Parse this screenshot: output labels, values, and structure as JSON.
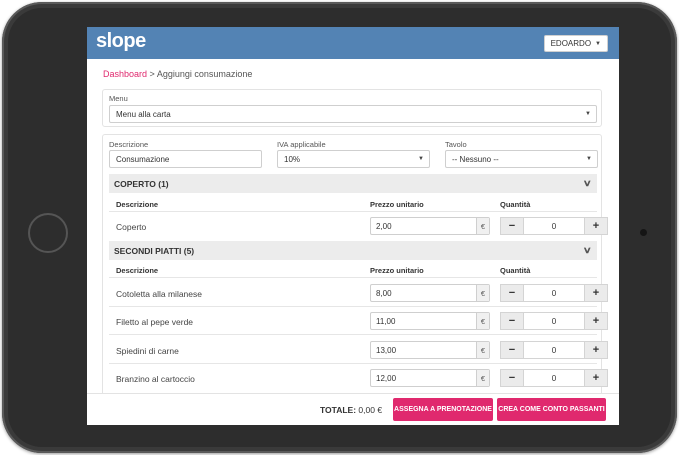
{
  "app": {
    "logo": "slope",
    "user": "EDOARDO"
  },
  "breadcrumb": {
    "home": "Dashboard",
    "separator": ">",
    "current": "Aggiungi consumazione"
  },
  "menu": {
    "label": "Menu",
    "value": "Menu alla carta"
  },
  "form": {
    "descrizione_label": "Descrizione",
    "descrizione_value": "Consumazione",
    "iva_label": "IVA applicabile",
    "iva_value": "10%",
    "tavolo_label": "Tavolo",
    "tavolo_value": "-- Nessuno --"
  },
  "columns": {
    "descrizione": "Descrizione",
    "prezzo": "Prezzo unitario",
    "quantita": "Quantità"
  },
  "currency": "€",
  "groups": [
    {
      "title": "COPERTO (1)",
      "items": [
        {
          "name": "Coperto",
          "price": "2,00",
          "qty": "0"
        }
      ]
    },
    {
      "title": "SECONDI PIATTI (5)",
      "items": [
        {
          "name": "Cotoletta alla milanese",
          "price": "8,00",
          "qty": "0"
        },
        {
          "name": "Filetto al pepe verde",
          "price": "11,00",
          "qty": "0"
        },
        {
          "name": "Spiedini di carne",
          "price": "13,00",
          "qty": "0"
        },
        {
          "name": "Branzino al cartoccio",
          "price": "12,00",
          "qty": "0"
        }
      ]
    }
  ],
  "footer": {
    "total_label": "TOTALE:",
    "total_value": "0,00 €",
    "assign_button": "ASSEGNA A PRENOTAZIONE",
    "create_button": "CREA COME CONTO PASSANTI"
  },
  "colors": {
    "topbar": "#5383b4",
    "accent": "#e0296e"
  }
}
